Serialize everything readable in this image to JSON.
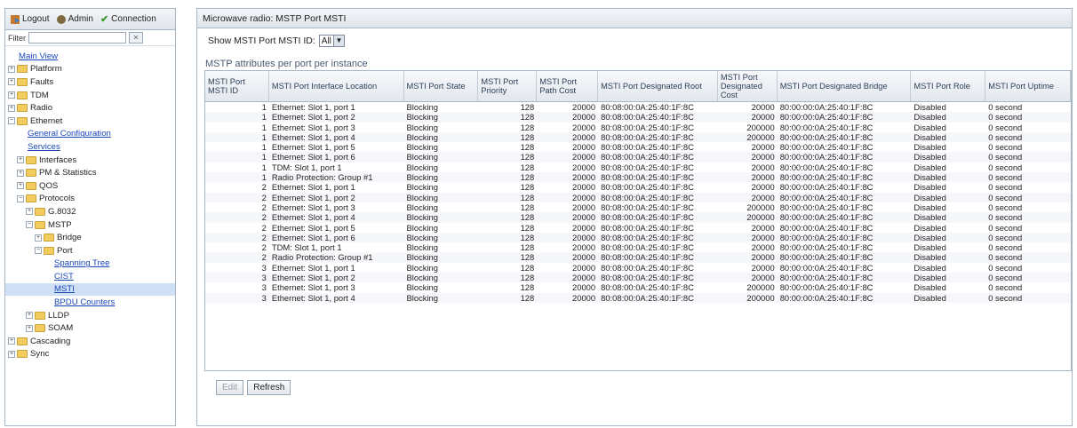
{
  "topbar": {
    "logout": "Logout",
    "admin": "Admin",
    "connection": "Connection"
  },
  "filter": {
    "label": "Filter",
    "value": ""
  },
  "tree": [
    {
      "label": "Main View",
      "level": 0,
      "type": "link"
    },
    {
      "label": "Platform",
      "level": 0,
      "type": "folder"
    },
    {
      "label": "Faults",
      "level": 0,
      "type": "folder"
    },
    {
      "label": "TDM",
      "level": 0,
      "type": "folder"
    },
    {
      "label": "Radio",
      "level": 0,
      "type": "folder"
    },
    {
      "label": "Ethernet",
      "level": 0,
      "type": "folder",
      "open": true
    },
    {
      "label": "General Configuration",
      "level": 1,
      "type": "link"
    },
    {
      "label": "Services",
      "level": 1,
      "type": "link"
    },
    {
      "label": "Interfaces",
      "level": 1,
      "type": "folder"
    },
    {
      "label": "PM & Statistics",
      "level": 1,
      "type": "folder"
    },
    {
      "label": "QOS",
      "level": 1,
      "type": "folder"
    },
    {
      "label": "Protocols",
      "level": 1,
      "type": "folder",
      "open": true
    },
    {
      "label": "G.8032",
      "level": 2,
      "type": "folder"
    },
    {
      "label": "MSTP",
      "level": 2,
      "type": "folder",
      "open": true
    },
    {
      "label": "Bridge",
      "level": 3,
      "type": "folder"
    },
    {
      "label": "Port",
      "level": 3,
      "type": "folder",
      "open": true
    },
    {
      "label": "Spanning Tree",
      "level": 4,
      "type": "link"
    },
    {
      "label": "CIST",
      "level": 4,
      "type": "link"
    },
    {
      "label": "MSTI",
      "level": 4,
      "type": "link",
      "selected": true
    },
    {
      "label": "BPDU Counters",
      "level": 4,
      "type": "link"
    },
    {
      "label": "LLDP",
      "level": 2,
      "type": "folder"
    },
    {
      "label": "SOAM",
      "level": 2,
      "type": "folder"
    },
    {
      "label": "Cascading",
      "level": 0,
      "type": "folder"
    },
    {
      "label": "Sync",
      "level": 0,
      "type": "folder"
    }
  ],
  "page": {
    "title": "Microwave radio: MSTP Port MSTI",
    "show_label": "Show MSTI Port MSTI ID:",
    "msti_selected": "All",
    "section_label": "MSTP attributes per port per instance"
  },
  "table": {
    "headers": [
      "MSTI Port MSTI ID",
      "MSTI Port Interface Location",
      "MSTI Port State",
      "MSTI Port Priority",
      "MSTI Port Path Cost",
      "MSTI Port Designated Root",
      "MSTI Port Designated Cost",
      "MSTI Port Designated Bridge",
      "MSTI Port Role",
      "MSTI Port Uptime"
    ],
    "rows": [
      [
        "1",
        "Ethernet: Slot 1, port 1",
        "Blocking",
        "128",
        "20000",
        "80:08:00:0A:25:40:1F:8C",
        "20000",
        "80:00:00:0A:25:40:1F:8C",
        "Disabled",
        "0 second"
      ],
      [
        "1",
        "Ethernet: Slot 1, port 2",
        "Blocking",
        "128",
        "20000",
        "80:08:00:0A:25:40:1F:8C",
        "20000",
        "80:00:00:0A:25:40:1F:8C",
        "Disabled",
        "0 second"
      ],
      [
        "1",
        "Ethernet: Slot 1, port 3",
        "Blocking",
        "128",
        "20000",
        "80:08:00:0A:25:40:1F:8C",
        "200000",
        "80:00:00:0A:25:40:1F:8C",
        "Disabled",
        "0 second"
      ],
      [
        "1",
        "Ethernet: Slot 1, port 4",
        "Blocking",
        "128",
        "20000",
        "80:08:00:0A:25:40:1F:8C",
        "200000",
        "80:00:00:0A:25:40:1F:8C",
        "Disabled",
        "0 second"
      ],
      [
        "1",
        "Ethernet: Slot 1, port 5",
        "Blocking",
        "128",
        "20000",
        "80:08:00:0A:25:40:1F:8C",
        "20000",
        "80:00:00:0A:25:40:1F:8C",
        "Disabled",
        "0 second"
      ],
      [
        "1",
        "Ethernet: Slot 1, port 6",
        "Blocking",
        "128",
        "20000",
        "80:08:00:0A:25:40:1F:8C",
        "20000",
        "80:00:00:0A:25:40:1F:8C",
        "Disabled",
        "0 second"
      ],
      [
        "1",
        "TDM: Slot 1, port 1",
        "Blocking",
        "128",
        "20000",
        "80:08:00:0A:25:40:1F:8C",
        "20000",
        "80:00:00:0A:25:40:1F:8C",
        "Disabled",
        "0 second"
      ],
      [
        "1",
        "Radio Protection: Group #1",
        "Blocking",
        "128",
        "20000",
        "80:08:00:0A:25:40:1F:8C",
        "20000",
        "80:00:00:0A:25:40:1F:8C",
        "Disabled",
        "0 second"
      ],
      [
        "2",
        "Ethernet: Slot 1, port 1",
        "Blocking",
        "128",
        "20000",
        "80:08:00:0A:25:40:1F:8C",
        "20000",
        "80:00:00:0A:25:40:1F:8C",
        "Disabled",
        "0 second"
      ],
      [
        "2",
        "Ethernet: Slot 1, port 2",
        "Blocking",
        "128",
        "20000",
        "80:08:00:0A:25:40:1F:8C",
        "20000",
        "80:00:00:0A:25:40:1F:8C",
        "Disabled",
        "0 second"
      ],
      [
        "2",
        "Ethernet: Slot 1, port 3",
        "Blocking",
        "128",
        "20000",
        "80:08:00:0A:25:40:1F:8C",
        "200000",
        "80:00:00:0A:25:40:1F:8C",
        "Disabled",
        "0 second"
      ],
      [
        "2",
        "Ethernet: Slot 1, port 4",
        "Blocking",
        "128",
        "20000",
        "80:08:00:0A:25:40:1F:8C",
        "200000",
        "80:00:00:0A:25:40:1F:8C",
        "Disabled",
        "0 second"
      ],
      [
        "2",
        "Ethernet: Slot 1, port 5",
        "Blocking",
        "128",
        "20000",
        "80:08:00:0A:25:40:1F:8C",
        "20000",
        "80:00:00:0A:25:40:1F:8C",
        "Disabled",
        "0 second"
      ],
      [
        "2",
        "Ethernet: Slot 1, port 6",
        "Blocking",
        "128",
        "20000",
        "80:08:00:0A:25:40:1F:8C",
        "20000",
        "80:00:00:0A:25:40:1F:8C",
        "Disabled",
        "0 second"
      ],
      [
        "2",
        "TDM: Slot 1, port 1",
        "Blocking",
        "128",
        "20000",
        "80:08:00:0A:25:40:1F:8C",
        "20000",
        "80:00:00:0A:25:40:1F:8C",
        "Disabled",
        "0 second"
      ],
      [
        "2",
        "Radio Protection: Group #1",
        "Blocking",
        "128",
        "20000",
        "80:08:00:0A:25:40:1F:8C",
        "20000",
        "80:00:00:0A:25:40:1F:8C",
        "Disabled",
        "0 second"
      ],
      [
        "3",
        "Ethernet: Slot 1, port 1",
        "Blocking",
        "128",
        "20000",
        "80:08:00:0A:25:40:1F:8C",
        "20000",
        "80:00:00:0A:25:40:1F:8C",
        "Disabled",
        "0 second"
      ],
      [
        "3",
        "Ethernet: Slot 1, port 2",
        "Blocking",
        "128",
        "20000",
        "80:08:00:0A:25:40:1F:8C",
        "20000",
        "80:00:00:0A:25:40:1F:8C",
        "Disabled",
        "0 second"
      ],
      [
        "3",
        "Ethernet: Slot 1, port 3",
        "Blocking",
        "128",
        "20000",
        "80:08:00:0A:25:40:1F:8C",
        "200000",
        "80:00:00:0A:25:40:1F:8C",
        "Disabled",
        "0 second"
      ],
      [
        "3",
        "Ethernet: Slot 1, port 4",
        "Blocking",
        "128",
        "20000",
        "80:08:00:0A:25:40:1F:8C",
        "200000",
        "80:00:00:0A:25:40:1F:8C",
        "Disabled",
        "0 second"
      ]
    ]
  },
  "buttons": {
    "edit": "Edit",
    "refresh": "Refresh"
  }
}
